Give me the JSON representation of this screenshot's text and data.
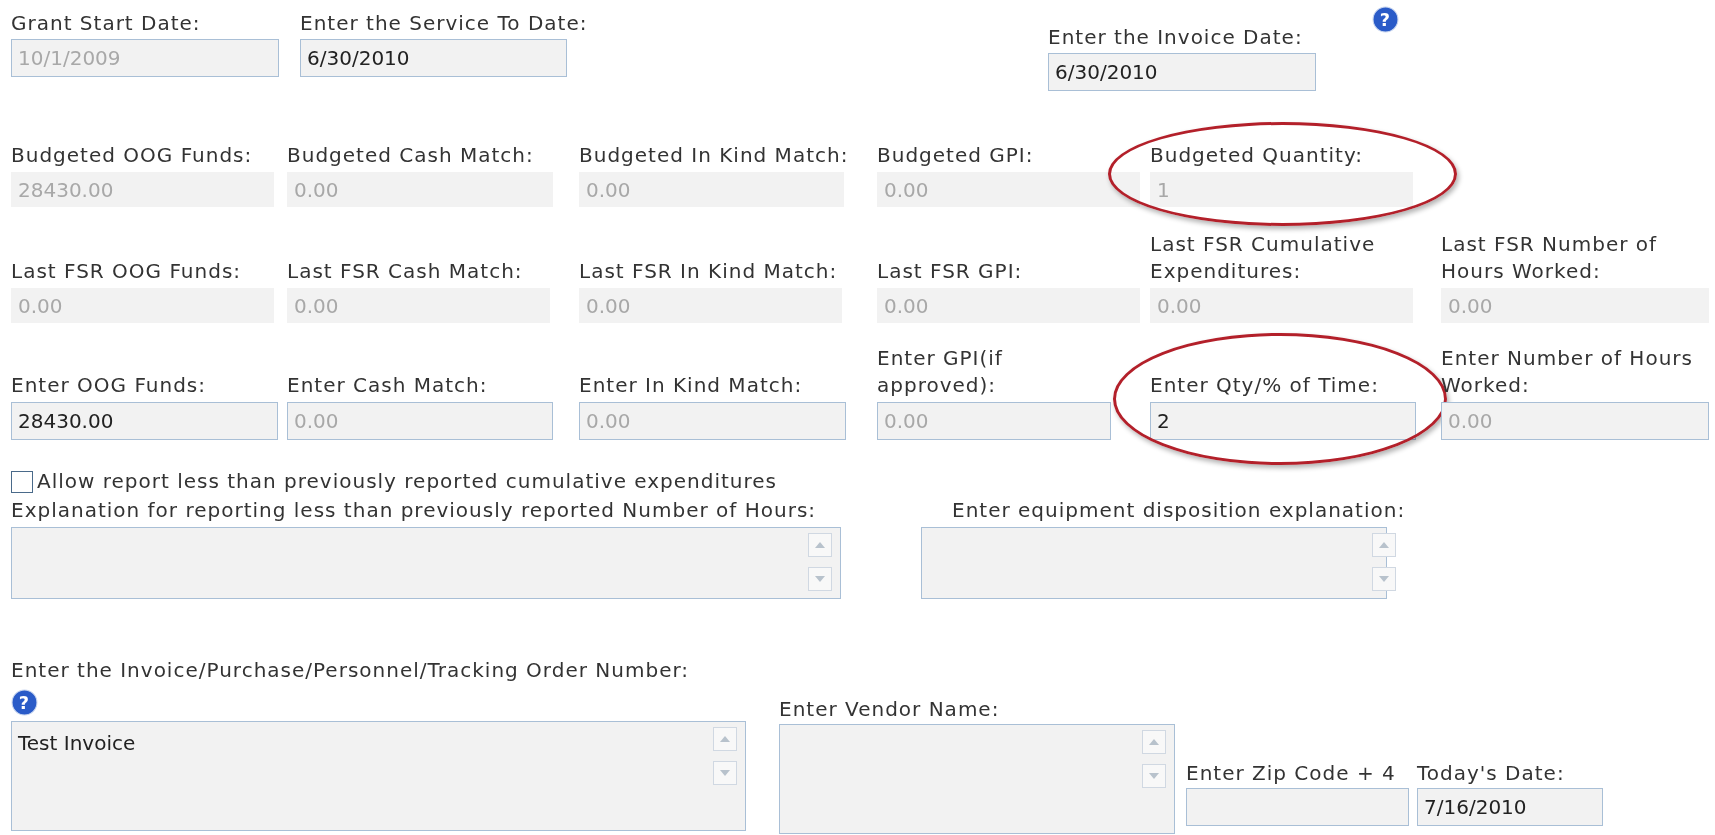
{
  "top_fields": [
    {
      "label": "Grant Start Date:",
      "value": "10/1/2009",
      "disabled": true
    },
    {
      "label": "Enter the Service To Date:",
      "value": "6/30/2010",
      "disabled": false
    },
    {
      "label": "Enter the Invoice Date:",
      "value": "6/30/2010",
      "disabled": false
    }
  ],
  "top_help": {
    "symbol": "?"
  },
  "rows": [
    {
      "kind": "display",
      "fields": [
        {
          "label": "Budgeted OOG Funds:",
          "value": "28430.00",
          "disabled": true,
          "highlighted": false
        },
        {
          "label": "Budgeted Cash Match:",
          "value": "0.00",
          "disabled": true,
          "highlighted": false
        },
        {
          "label": "Budgeted In Kind Match:",
          "value": "0.00",
          "disabled": true,
          "highlighted": false
        },
        {
          "label": "Budgeted GPI:",
          "value": "0.00",
          "disabled": true,
          "highlighted": false
        },
        {
          "label": "Budgeted Quantity:",
          "value": "1",
          "disabled": true,
          "highlighted": true
        }
      ]
    },
    {
      "kind": "display",
      "fields": [
        {
          "label": "Last FSR OOG Funds:",
          "value": "0.00",
          "disabled": true,
          "highlighted": false
        },
        {
          "label": "Last FSR Cash Match:",
          "value": "0.00",
          "disabled": true,
          "highlighted": false
        },
        {
          "label": "Last FSR In Kind Match:",
          "value": "0.00",
          "disabled": true,
          "highlighted": false
        },
        {
          "label": "Last FSR GPI:",
          "value": "0.00",
          "disabled": true,
          "highlighted": false
        },
        {
          "label": "Last FSR Cumulative Expenditures:",
          "value": "0.00",
          "disabled": true,
          "highlighted": false
        },
        {
          "label": "Last FSR Number of Hours Worked:",
          "value": "0.00",
          "disabled": true,
          "highlighted": false
        }
      ]
    },
    {
      "kind": "input",
      "fields": [
        {
          "label": "Enter OOG Funds:",
          "value": "28430.00",
          "disabled": false,
          "highlighted": false
        },
        {
          "label": "Enter Cash Match:",
          "value": "0.00",
          "disabled": true,
          "highlighted": false
        },
        {
          "label": "Enter In Kind Match:",
          "value": "0.00",
          "disabled": true,
          "highlighted": false
        },
        {
          "label": "Enter GPI(if approved):",
          "value": "0.00",
          "disabled": true,
          "highlighted": false
        },
        {
          "label": "Enter Qty/% of Time:",
          "value": "2",
          "disabled": false,
          "highlighted": true
        },
        {
          "label": "Enter Number of Hours Worked:",
          "value": "0.00",
          "disabled": true,
          "highlighted": false
        }
      ]
    }
  ],
  "allow_checkbox": {
    "label": "Allow report less than previously reported cumulative expenditures",
    "checked": false
  },
  "explanations": [
    {
      "label": "Explanation for reporting less than previously reported Number of Hours:"
    },
    {
      "label": "Enter equipment disposition explanation:"
    }
  ],
  "invoice_number": {
    "label": "Enter the Invoice/Purchase/Personnel/Tracking Order Number:",
    "value": "Test Invoice",
    "help": {
      "symbol": "?"
    }
  },
  "vendor_name": {
    "label": "Enter Vendor Name:"
  },
  "zip_code": {
    "label": "Enter Zip Code + 4"
  },
  "todays_date": {
    "label": "Today's Date:",
    "value": "7/16/2010"
  }
}
